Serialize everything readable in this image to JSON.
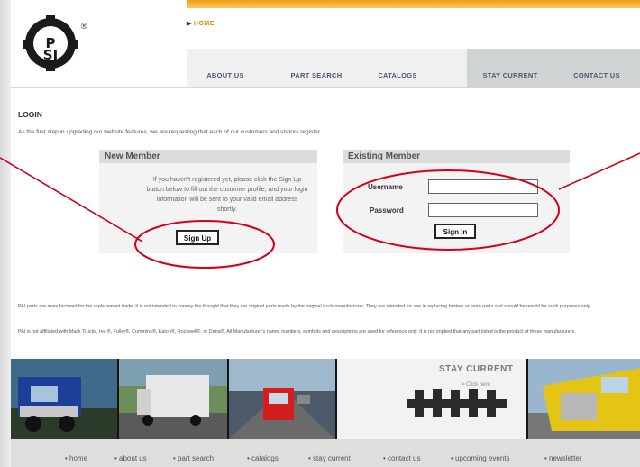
{
  "header": {
    "logo_text": "P\nSI",
    "registered_mark": "®",
    "breadcrumb": "HOME"
  },
  "nav": {
    "items": [
      "ABOUT US",
      "PART SEARCH",
      "CATALOGS",
      "STAY CURRENT",
      "CONTACT US"
    ]
  },
  "login": {
    "title": "LOGIN",
    "intro": "As the first step in upgrading our website features, we are requesting that each of our customers and visitors register.",
    "new_member": {
      "heading": "New Member",
      "text": "If you haven't registered yet, please click the Sign Up button below to fill out the customer profile, and your login information will be sent to your valid email address shortly.",
      "button": "Sign Up"
    },
    "existing_member": {
      "heading": "Existing Member",
      "username_label": "Username",
      "password_label": "Password",
      "username_value": "",
      "password_value": "",
      "button": "Sign In"
    }
  },
  "disclaimers": {
    "line1": "PAI parts are manufactured for the replacement trade. It is not intended to convey the thought that they are original parts made by the original truck manufacturer. They are intended for use in replacing broken or worn parts and should be resold for such purposes only.",
    "line2": "PAI is not affiliated with Mack Trucks, Inc.®, Fuller®, Cummins®, Eaton®, Rockwell®, or Dana®. All Manufacturer's name, numbers, symbols and descriptions are used for reference only. It is not implied that any part listed is the product of these manufacturers."
  },
  "banner": {
    "stay_current": "STAY CURRENT",
    "stay_current_sub": "> Click here"
  },
  "footer": {
    "links": [
      "• home",
      "• about us",
      "• part search",
      "• catalogs",
      "• stay current",
      "• contact us",
      "• upcoming events",
      "• newsletter"
    ]
  },
  "colors": {
    "accent_orange": "#f0a010",
    "annotation_red": "#d0021b",
    "nav_text": "#4a5a6a"
  }
}
